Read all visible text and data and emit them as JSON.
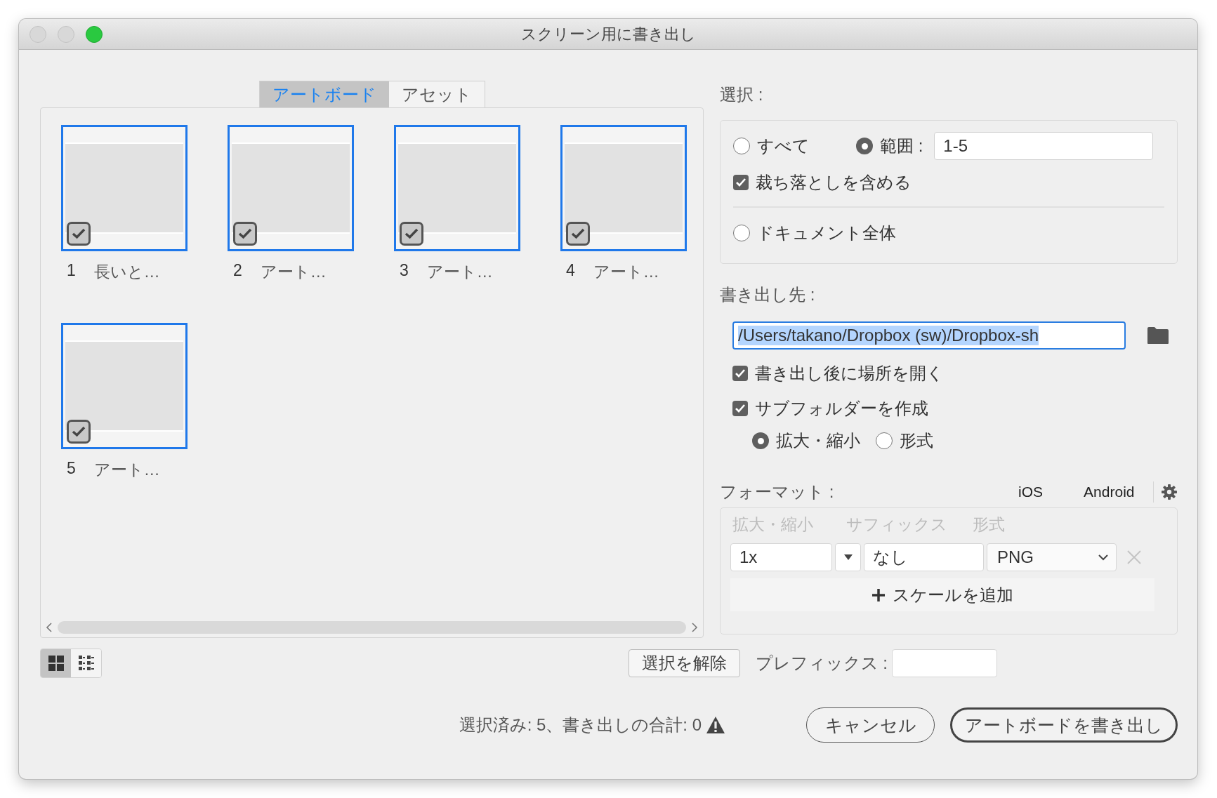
{
  "window": {
    "title": "スクリーン用に書き出し"
  },
  "tabs": [
    {
      "label": "アートボード",
      "selected": true
    },
    {
      "label": "アセット",
      "selected": false
    }
  ],
  "artboards": [
    {
      "number": "1",
      "name": "長いと…",
      "selected": true,
      "checked": true
    },
    {
      "number": "2",
      "name": "アート…",
      "selected": true,
      "checked": true
    },
    {
      "number": "3",
      "name": "アート…",
      "selected": true,
      "checked": true
    },
    {
      "number": "4",
      "name": "アート…",
      "selected": true,
      "checked": true
    },
    {
      "number": "5",
      "name": "アート…",
      "selected": true,
      "checked": true
    }
  ],
  "view_modes": [
    {
      "kind": "grid",
      "selected": true
    },
    {
      "kind": "list",
      "selected": false
    }
  ],
  "selection": {
    "label": "選択 :",
    "all": {
      "label": "すべて",
      "selected": false
    },
    "range": {
      "label": "範囲 :",
      "selected": true,
      "value": "1-5"
    },
    "include_bleed": {
      "label": "裁ち落としを含める",
      "checked": true
    },
    "whole_document": {
      "label": "ドキュメント全体",
      "selected": false
    }
  },
  "export_to": {
    "label": "書き出し先 :",
    "path": "/Users/takano/Dropbox (sw)/Dropbox-sh",
    "open_after": {
      "label": "書き出し後に場所を開く",
      "checked": true
    },
    "create_subfolder": {
      "label": "サブフォルダーを作成",
      "checked": true
    },
    "subfolder_by": [
      {
        "label": "拡大・縮小",
        "selected": true
      },
      {
        "label": "形式",
        "selected": false
      }
    ]
  },
  "format": {
    "label": "フォーマット :",
    "presets": [
      "iOS",
      "Android"
    ],
    "columns": [
      "拡大・縮小",
      "サフィックス",
      "形式"
    ],
    "rows": [
      {
        "scale": "1x",
        "suffix": "なし",
        "format": "PNG"
      }
    ],
    "add_scale": "スケールを追加"
  },
  "deselect_button": "選択を解除",
  "prefix_label": "プレフィックス :",
  "status": "選択済み: 5、書き出しの合計: 0",
  "buttons": [
    {
      "kind": "cancel",
      "label": "キャンセル"
    },
    {
      "kind": "default",
      "label": "アートボードを書き出し"
    }
  ]
}
